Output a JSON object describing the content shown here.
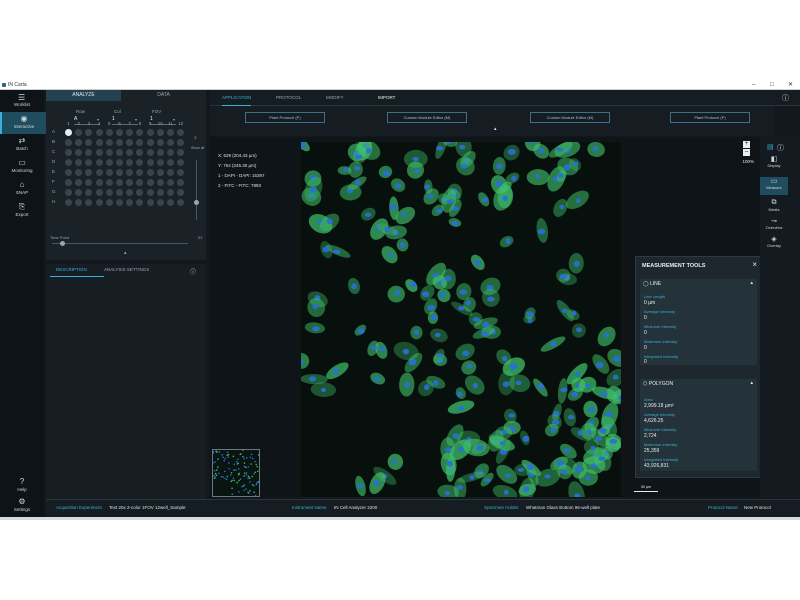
{
  "window": {
    "title": "IN Carta"
  },
  "nav": {
    "worklist": "Worklist",
    "items": [
      {
        "label": "Interactive",
        "icon": "eye-icon",
        "active": true
      },
      {
        "label": "Batch",
        "icon": "batch-icon"
      },
      {
        "label": "Monitoring",
        "icon": "monitor-icon"
      },
      {
        "label": "SNAP",
        "icon": "snap-icon"
      },
      {
        "label": "Export",
        "icon": "export-icon"
      }
    ],
    "help": "Help",
    "settings": "Settings"
  },
  "panel": {
    "tabs": [
      "ANALYZE",
      "DATA"
    ],
    "row_label": "Row",
    "row_value": "A",
    "col_label": "Col",
    "col_value": "1",
    "fov_label": "FOV",
    "fov_value": "1",
    "columns": [
      "1",
      "2",
      "3",
      "4",
      "5",
      "6",
      "7",
      "8",
      "9",
      "10",
      "11",
      "12"
    ],
    "rows": [
      "A",
      "B",
      "C",
      "D",
      "E",
      "F",
      "G",
      "H"
    ],
    "show_all": "Show all",
    "time_point_label": "Time Point",
    "time_point_value": "01"
  },
  "panel2": {
    "tabs": [
      "DESCRIPTION",
      "ANALYSIS SETTINGS"
    ]
  },
  "toptabs": [
    "APPLICATION",
    "PROTOCOL",
    "MODIFY",
    "IMPORT"
  ],
  "protocol_buttons": [
    "Plant Protocol (P)",
    "Custom Module Editor (M)",
    "Custom Module Editor (M)",
    "Plant Protocol (P)"
  ],
  "viewer": {
    "readout": [
      "X: 629 (204.43 µm)",
      "Y: 754 (245.30 µm)",
      "1 - DAPI - DAPI: 15397",
      "2 - FITC - FITC: 7893"
    ],
    "zoom": "100%",
    "scale": "50 µm"
  },
  "measure": {
    "title": "MEASUREMENT TOOLS",
    "line": {
      "title": "LINE",
      "fields": [
        {
          "label": "Line Length",
          "value": "0 µm"
        },
        {
          "label": "Average Intensity",
          "value": "0"
        },
        {
          "label": "Minimum Intensity",
          "value": "0"
        },
        {
          "label": "Maximum Intensity",
          "value": "0"
        },
        {
          "label": "Integrated Intensity",
          "value": "0"
        }
      ]
    },
    "polygon": {
      "title": "POLYGON",
      "fields": [
        {
          "label": "Area",
          "value": "2,999.18 µm²"
        },
        {
          "label": "Average Intensity",
          "value": "4,626.25"
        },
        {
          "label": "Minimum Intensity",
          "value": "2,724"
        },
        {
          "label": "Maximum Intensity",
          "value": "25,359"
        },
        {
          "label": "Integrated Intensity",
          "value": "43,926,831"
        }
      ]
    }
  },
  "right_toolbar": [
    "Display",
    "Measure",
    "Media",
    "Overview",
    "Overlay"
  ],
  "status": {
    "acq_label": "Acquisition Experiment",
    "acq_value": "Test 20x 2-color 1FOV 12well_Sample",
    "inst_label": "Instrument Name",
    "inst_value": "IN Cell Analyzer 2200",
    "spec_label": "Specimen Holder",
    "spec_value": "Whatman Glass Bottom 96-well plate",
    "proto_label": "Protocol Name",
    "proto_value": "New Protocol"
  },
  "colors": {
    "accent": "#3ab0d8",
    "nuclei": "#2a6fd6",
    "cytoplasm": "#3fbf6a"
  }
}
